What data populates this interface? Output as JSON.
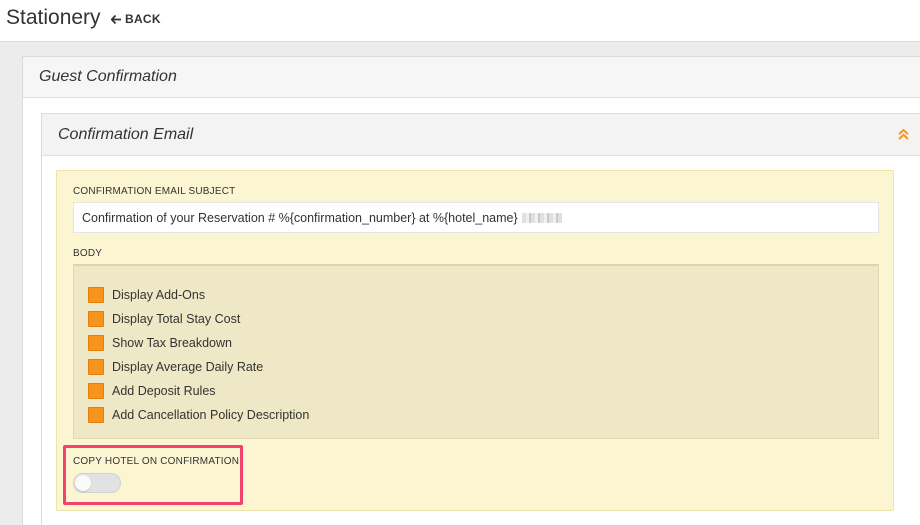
{
  "header": {
    "title": "Stationery",
    "back_label": "BACK"
  },
  "outer_panel": {
    "title": "Guest Confirmation"
  },
  "inner_panel": {
    "title": "Confirmation Email",
    "collapse_icon": "chevron-double-up-icon"
  },
  "subject": {
    "label": "CONFIRMATION EMAIL SUBJECT",
    "value": "Confirmation of your Reservation # %{confirmation_number} at %{hotel_name}"
  },
  "body": {
    "label": "BODY",
    "items": [
      {
        "label": "Display Add-Ons"
      },
      {
        "label": "Display Total Stay Cost"
      },
      {
        "label": "Show Tax Breakdown"
      },
      {
        "label": "Display Average Daily Rate"
      },
      {
        "label": "Add Deposit Rules"
      },
      {
        "label": "Add Cancellation Policy Description"
      }
    ]
  },
  "copy_hotel": {
    "label": "COPY HOTEL ON CONFIRMATION",
    "enabled": false
  },
  "colors": {
    "accent": "#f7941d",
    "highlight": "#f0446e",
    "panel_yellow": "#fcf5d2"
  }
}
